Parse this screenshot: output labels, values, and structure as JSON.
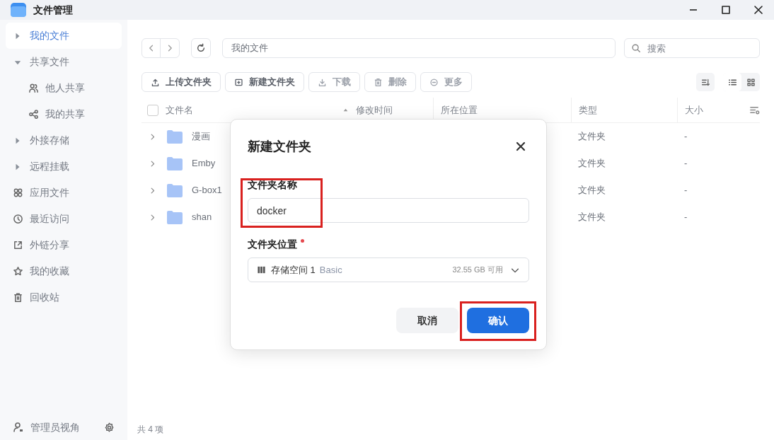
{
  "window": {
    "title": "文件管理"
  },
  "sidebar": {
    "items": [
      {
        "kind": "expander",
        "label": "我的文件",
        "selected": true,
        "expanded": false
      },
      {
        "kind": "expander",
        "label": "共享文件",
        "selected": false,
        "expanded": true,
        "children": [
          {
            "label": "他人共享",
            "selected": false
          },
          {
            "label": "我的共享",
            "selected": false
          }
        ]
      },
      {
        "kind": "expander",
        "label": "外接存储",
        "selected": false,
        "expanded": false
      },
      {
        "kind": "expander",
        "label": "远程挂载",
        "selected": false,
        "expanded": false
      },
      {
        "kind": "icon",
        "label": "应用文件",
        "selected": false
      },
      {
        "kind": "icon",
        "label": "最近访问",
        "selected": false
      },
      {
        "kind": "icon",
        "label": "外链分享",
        "selected": false
      },
      {
        "kind": "icon",
        "label": "我的收藏",
        "selected": false
      },
      {
        "kind": "icon",
        "label": "回收站",
        "selected": false
      }
    ],
    "footer": "管理员视角"
  },
  "path": "我的文件",
  "search": {
    "placeholder": "搜索"
  },
  "toolbar": [
    {
      "label": "上传文件夹",
      "disabled": false
    },
    {
      "label": "新建文件夹",
      "disabled": false
    },
    {
      "label": "下载",
      "disabled": true
    },
    {
      "label": "删除",
      "disabled": true
    },
    {
      "label": "更多",
      "disabled": true
    }
  ],
  "table": {
    "select_all": {
      "checked": false
    },
    "columns": [
      "文件名",
      "修改时间",
      "所在位置",
      "类型",
      "大小"
    ],
    "rows": [
      {
        "name": "漫画",
        "type": "文件夹",
        "size": "-"
      },
      {
        "name": "Emby",
        "type": "文件夹",
        "size": "-"
      },
      {
        "name": "G-box1",
        "type": "文件夹",
        "size": "-"
      },
      {
        "name": "shan",
        "type": "文件夹",
        "size": "-"
      }
    ]
  },
  "status_bar": "共 4 项",
  "dialog": {
    "title": "新建文件夹",
    "fields": [
      {
        "kind": "text",
        "label": "文件夹名称",
        "required": false,
        "value": "docker"
      },
      {
        "kind": "select",
        "label": "文件夹位置",
        "required": true,
        "value": "存储空间 1",
        "tag": "Basic",
        "note": "32.55 GB 可用"
      }
    ],
    "buttons": [
      {
        "label": "取消",
        "primary": false
      },
      {
        "label": "确认",
        "primary": true
      }
    ]
  }
}
